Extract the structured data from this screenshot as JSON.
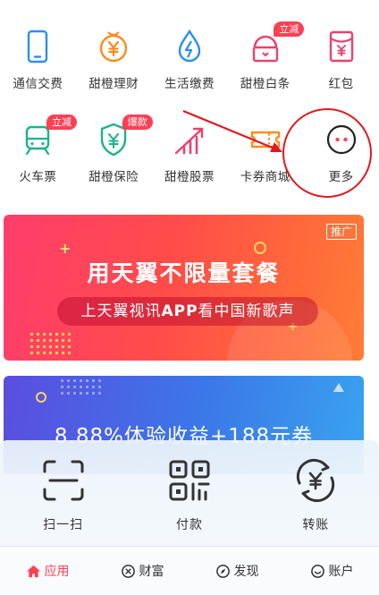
{
  "services_row1": [
    {
      "label": "通信交费",
      "icon": "phone-icon"
    },
    {
      "label": "甜橙理财",
      "icon": "yuan-coin-icon"
    },
    {
      "label": "生活缴费",
      "icon": "water-drop-icon"
    },
    {
      "label": "甜橙白条",
      "icon": "card-icon",
      "badge": "立减"
    },
    {
      "label": "红包",
      "icon": "red-envelope-icon"
    }
  ],
  "services_row2": [
    {
      "label": "火车票",
      "icon": "train-icon",
      "badge": "立减"
    },
    {
      "label": "甜橙保险",
      "icon": "shield-icon",
      "badge": "爆款"
    },
    {
      "label": "甜橙股票",
      "icon": "stock-chart-icon"
    },
    {
      "label": "卡券商城",
      "icon": "ticket-icon"
    },
    {
      "label": "更多",
      "icon": "more-dots-icon"
    }
  ],
  "banner1": {
    "title": "用天翼不限量套餐",
    "subtitle_pre": "上天翼视讯",
    "subtitle_bold": "APP",
    "subtitle_post": "看中国新歌声",
    "ad_tag": "推广"
  },
  "banner2": {
    "title": "8.88%体验收益+188元券"
  },
  "dock": [
    {
      "label": "扫一扫",
      "icon": "scan-icon"
    },
    {
      "label": "付款",
      "icon": "qrcode-icon"
    },
    {
      "label": "转账",
      "icon": "transfer-icon"
    }
  ],
  "tabbar": [
    {
      "label": "应用",
      "icon": "home-icon",
      "active": true
    },
    {
      "label": "财富",
      "icon": "wealth-icon"
    },
    {
      "label": "发现",
      "icon": "compass-icon"
    },
    {
      "label": "账户",
      "icon": "smile-icon"
    }
  ],
  "colors": {
    "accent": "#ff3f54",
    "blue": "#2b8ff0",
    "orange": "#ff8a1f",
    "green": "#1bb38a",
    "pink": "#e8436e",
    "highlight": "#e0191e"
  }
}
